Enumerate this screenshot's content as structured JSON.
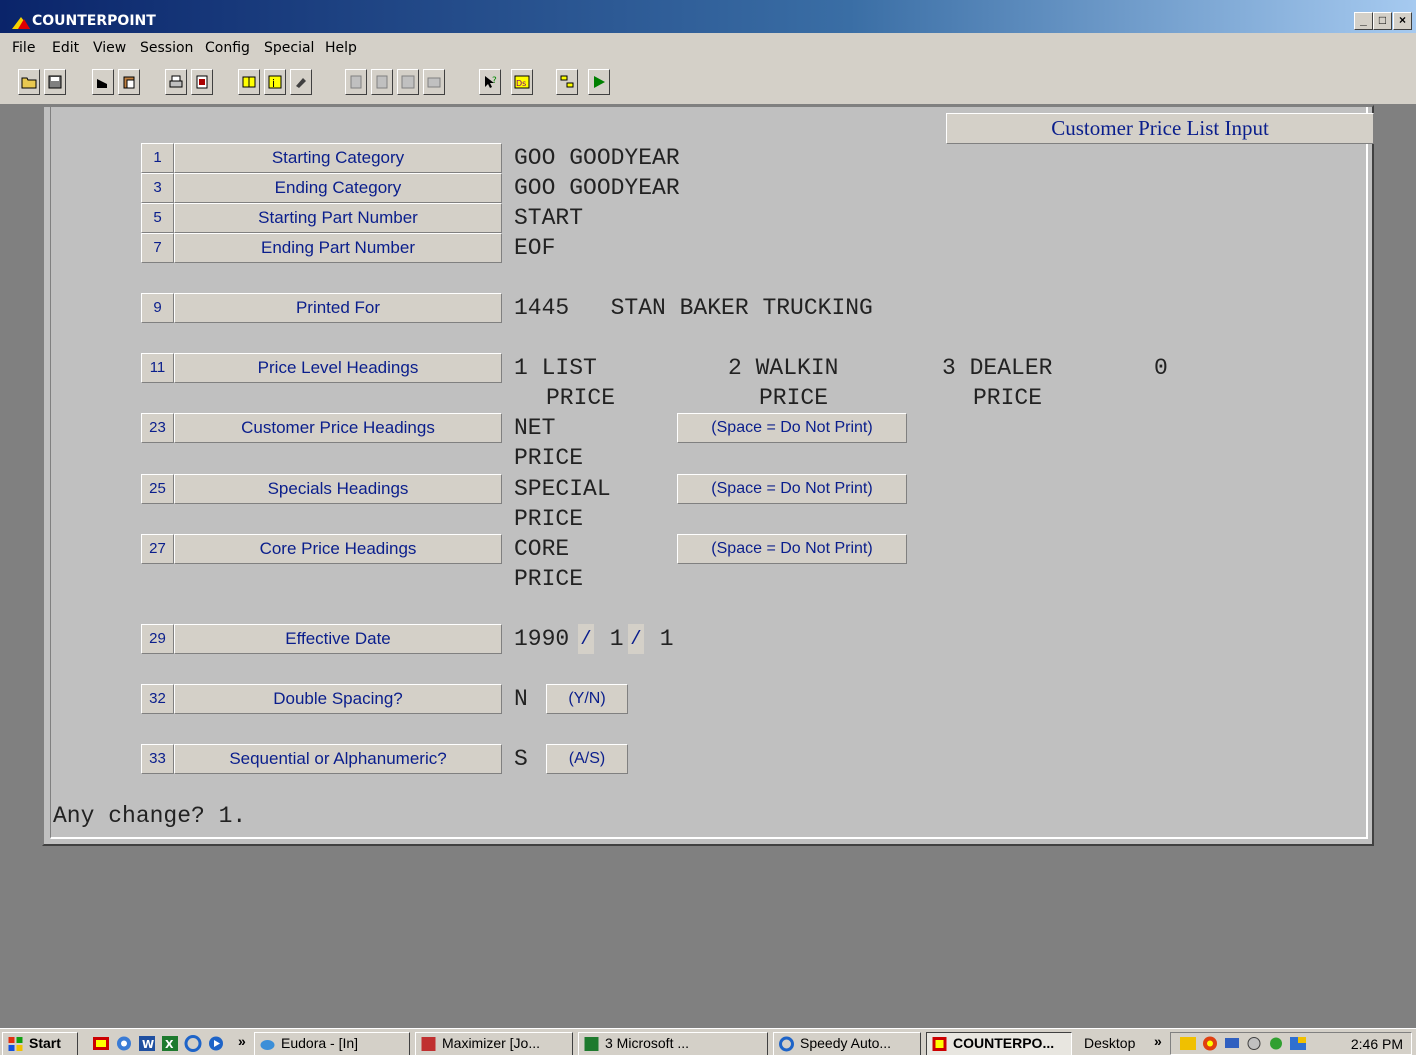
{
  "window": {
    "title": "COUNTERPOINT",
    "min_label": "_",
    "max_label": "□",
    "close_label": "×"
  },
  "menu": [
    "File",
    "Edit",
    "View",
    "Session",
    "Config",
    "Special",
    "Help"
  ],
  "toolbar_icons": [
    "open-folder-icon",
    "save-disk-icon",
    "cut-icon",
    "paste-icon",
    "print-icon",
    "printer-setup-icon",
    "window-icon",
    "info-icon",
    "zoom-icon",
    "doc-icon",
    "doc2-icon",
    "font-icon",
    "keyboard-icon",
    "help-pointer-icon",
    "dos-icon",
    "tree-icon",
    "run-icon"
  ],
  "form": {
    "title": "Customer Price List Input",
    "fields": [
      {
        "num": "1",
        "label": "Starting Category",
        "value": "GOO GOODYEAR"
      },
      {
        "num": "3",
        "label": "Ending Category",
        "value": "GOO GOODYEAR"
      },
      {
        "num": "5",
        "label": "Starting Part Number",
        "value": "START"
      },
      {
        "num": "7",
        "label": "Ending Part Number",
        "value": "EOF"
      },
      {
        "num": "9",
        "label": "Printed For",
        "value": "1445   STAN BAKER TRUCKING"
      },
      {
        "num": "11",
        "label": "Price Level Headings",
        "value": ""
      },
      {
        "num": "23",
        "label": "Customer Price Headings",
        "value": "NET"
      },
      {
        "num": "25",
        "label": "Specials Headings",
        "value": "SPECIAL"
      },
      {
        "num": "27",
        "label": "Core Price Headings",
        "value": "CORE"
      },
      {
        "num": "29",
        "label": "Effective Date",
        "value": ""
      },
      {
        "num": "32",
        "label": "Double Spacing?",
        "value": "N"
      },
      {
        "num": "33",
        "label": "Sequential or Alphanumeric?",
        "value": "S"
      }
    ],
    "price_levels": [
      {
        "line1": "1 LIST",
        "line2": "PRICE"
      },
      {
        "line1": "2 WALKIN",
        "line2": "PRICE"
      },
      {
        "line1": "3 DEALER",
        "line2": "PRICE"
      },
      {
        "line1": "0",
        "line2": ""
      }
    ],
    "customer_price_line2": "PRICE",
    "specials_line2": "PRICE",
    "core_line2": "PRICE",
    "space_hint": "(Space = Do Not Print)",
    "date": {
      "year": "1990",
      "sep": "/",
      "month": " 1",
      "day": " 1"
    },
    "yn_hint": "(Y/N)",
    "as_hint": "(A/S)",
    "prompt": "Any change? 1."
  },
  "taskbar": {
    "start": "Start",
    "chevron": "»",
    "tasks": [
      {
        "label": "Eudora - [In]",
        "active": false
      },
      {
        "label": "Maximizer [Jo...",
        "active": false
      },
      {
        "label": "3 Microsoft ...",
        "active": false
      },
      {
        "label": "Speedy Auto...",
        "active": false
      },
      {
        "label": "COUNTERPO...",
        "active": true
      }
    ],
    "desktop": "Desktop",
    "clock": "2:46 PM"
  },
  "colors": {
    "label_text": "#0a1e8c",
    "panel_bg": "#c0c0c0",
    "desktop_bg": "#808080"
  }
}
